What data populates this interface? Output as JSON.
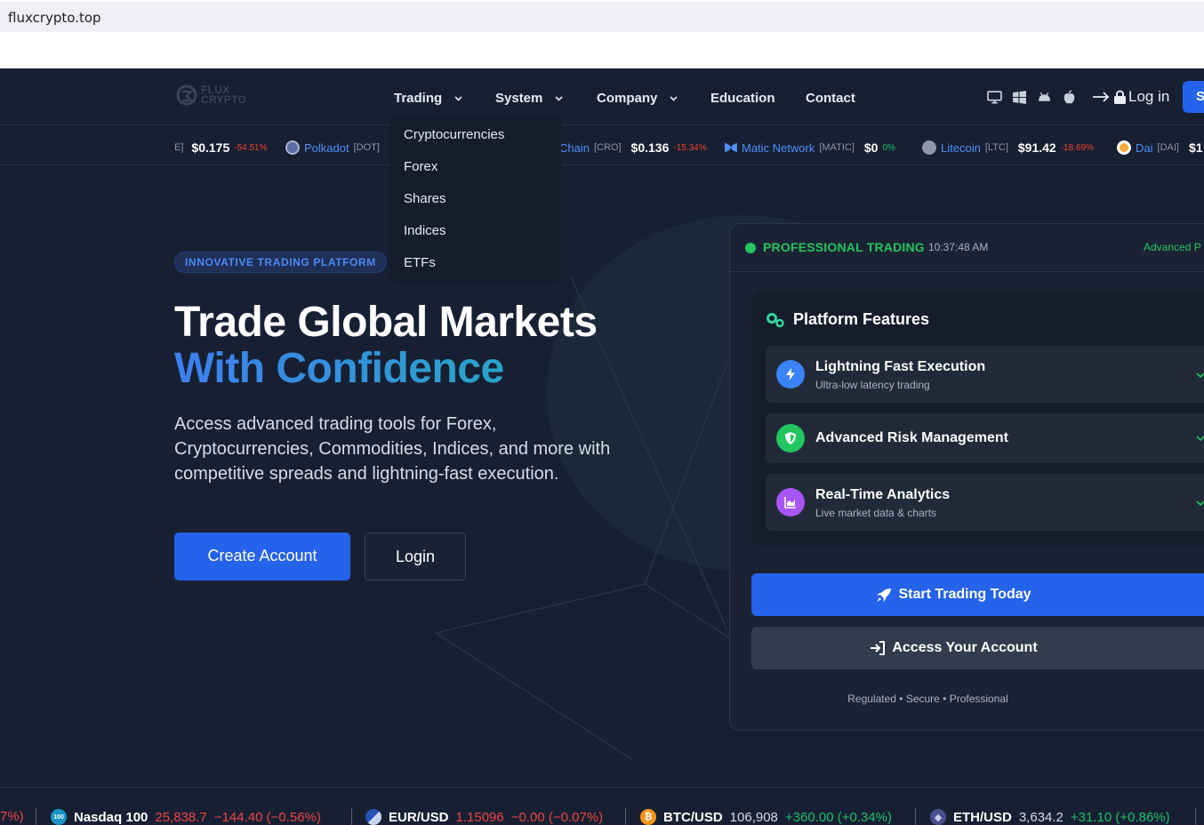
{
  "browser": {
    "url": "fluxcrypto.top"
  },
  "nav": {
    "logo_line1": "FLUX",
    "logo_line2": "CRYPTO",
    "items": [
      {
        "label": "Trading",
        "has_dropdown": true
      },
      {
        "label": "System",
        "has_dropdown": true
      },
      {
        "label": "Company",
        "has_dropdown": true
      },
      {
        "label": "Education",
        "has_dropdown": false
      },
      {
        "label": "Contact",
        "has_dropdown": false
      }
    ],
    "platform_icons": [
      "desktop-icon",
      "windows-icon",
      "android-icon",
      "apple-icon"
    ],
    "login_label": "Log in",
    "signup_label_visible": "S"
  },
  "trading_dropdown": [
    "Cryptocurrencies",
    "Forex",
    "Shares",
    "Indices",
    "ETFs"
  ],
  "top_ticker": [
    {
      "symbol": "E]",
      "price": "$0.175",
      "change": "-54.51%",
      "direction": "down"
    },
    {
      "name": "Polkadot",
      "symbol": "[DOT]"
    },
    {
      "name": "Chain",
      "symbol": "[CRO]",
      "price": "$0.136",
      "change": "-15.34%",
      "direction": "down"
    },
    {
      "name": "Matic Network",
      "symbol": "[MATIC]",
      "price": "$0",
      "change": "0%",
      "direction": "up"
    },
    {
      "name": "Litecoin",
      "symbol": "[LTC]",
      "price": "$91.42",
      "change": "-18.69%",
      "direction": "down"
    },
    {
      "name": "Dai",
      "symbol": "[DAI]",
      "price": "$1"
    }
  ],
  "hero": {
    "badge": "INNOVATIVE TRADING PLATFORM",
    "title_line1": "Trade Global Markets",
    "title_line2": "With Confidence",
    "description": "Access advanced trading tools for Forex, Cryptocurrencies, Commodities, Indices, and more with competitive spreads and lightning-fast execution.",
    "primary_cta": "Create Account",
    "secondary_cta": "Login"
  },
  "panel": {
    "status": "PROFESSIONAL TRADING",
    "time": "10:37:48 AM",
    "right_label": "Advanced P",
    "features_title": "Platform Features",
    "features": [
      {
        "title": "Lightning Fast Execution",
        "subtitle": "Ultra-low latency trading",
        "icon": "bolt-icon",
        "color": "#3b82f6"
      },
      {
        "title": "Advanced Risk Management",
        "subtitle": "",
        "icon": "shield-icon",
        "color": "#22c55e"
      },
      {
        "title": "Real-Time Analytics",
        "subtitle": "Live market data & charts",
        "icon": "chart-area-icon",
        "color": "#a855f7"
      }
    ],
    "cta_start": "Start Trading Today",
    "cta_access": "Access Your Account",
    "footnote": "Regulated • Secure • Professional"
  },
  "bottom_ticker": [
    {
      "label": "7%)",
      "direction": "down"
    },
    {
      "label": "Nasdaq 100",
      "value": "25,838.7",
      "change": "−144.40 (−0.56%)",
      "direction": "down"
    },
    {
      "label": "EUR/USD",
      "value": "1.15096",
      "change": "−0.00 (−0.07%)",
      "direction": "down"
    },
    {
      "label": "BTC/USD",
      "value": "106,908",
      "change": "+360.00 (+0.34%)",
      "direction": "up"
    },
    {
      "label": "ETH/USD",
      "value": "3,634.2",
      "change": "+31.10 (+0.86%)",
      "direction": "up"
    }
  ],
  "colors": {
    "accent": "#2563eb",
    "background": "#172033",
    "success": "#22c55e",
    "danger": "#ef4444"
  }
}
